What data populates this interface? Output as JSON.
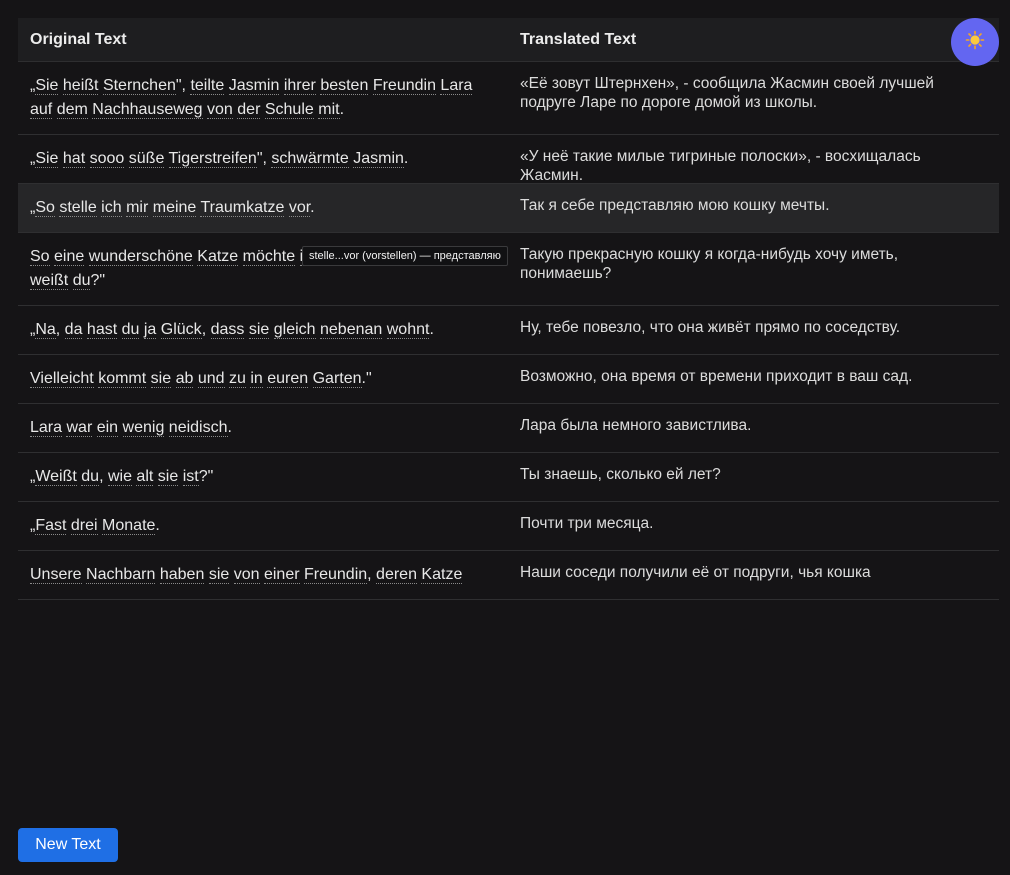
{
  "header": {
    "original_label": "Original Text",
    "translated_label": "Translated Text"
  },
  "theme_toggle": {
    "icon": "sun-icon"
  },
  "rows": [
    {
      "original": [
        {
          "t": "„"
        },
        {
          "w": "Sie"
        },
        {
          "t": " "
        },
        {
          "w": "heißt"
        },
        {
          "t": " "
        },
        {
          "w": "Sternchen"
        },
        {
          "t": "\", "
        },
        {
          "w": "teilte"
        },
        {
          "t": " "
        },
        {
          "w": "Jasmin"
        },
        {
          "t": " "
        },
        {
          "w": "ihrer"
        },
        {
          "t": " "
        },
        {
          "w": "besten"
        },
        {
          "t": " "
        },
        {
          "w": "Freundin"
        },
        {
          "t": " "
        },
        {
          "w": "Lara"
        },
        {
          "t": " "
        },
        {
          "w": "auf"
        },
        {
          "t": " "
        },
        {
          "w": "dem"
        },
        {
          "t": " "
        },
        {
          "w": "Nachhauseweg"
        },
        {
          "t": " "
        },
        {
          "w": "von"
        },
        {
          "t": " "
        },
        {
          "w": "der"
        },
        {
          "t": " "
        },
        {
          "w": "Schule"
        },
        {
          "t": " "
        },
        {
          "w": "mit"
        },
        {
          "t": "."
        }
      ],
      "translated": "«Её зовут Штернхен», - сообщила Жасмин своей лучшей подруге Ларе по дороге домой из школы."
    },
    {
      "original": [
        {
          "t": "„"
        },
        {
          "w": "Sie"
        },
        {
          "t": " "
        },
        {
          "w": "hat"
        },
        {
          "t": " "
        },
        {
          "w": "sooo"
        },
        {
          "t": " "
        },
        {
          "w": "süße"
        },
        {
          "t": " "
        },
        {
          "w": "Tigerstreifen"
        },
        {
          "t": "\", "
        },
        {
          "w": "schwärmte"
        },
        {
          "t": " "
        },
        {
          "w": "Jasmin"
        },
        {
          "t": "."
        }
      ],
      "translated": "«У неё такие милые тигриные полоски», - восхищалась Жасмин."
    },
    {
      "highlighted": true,
      "original": [
        {
          "t": "„"
        },
        {
          "w": "So"
        },
        {
          "t": " "
        },
        {
          "w": "stelle"
        },
        {
          "t": " "
        },
        {
          "w": "ich"
        },
        {
          "t": " "
        },
        {
          "w": "mir"
        },
        {
          "t": " "
        },
        {
          "w": "meine"
        },
        {
          "t": " "
        },
        {
          "w": "Traumkatze"
        },
        {
          "t": " "
        },
        {
          "w": "vor"
        },
        {
          "t": "."
        }
      ],
      "translated": "Так я себе представляю мою кошку мечты."
    },
    {
      "original": [
        {
          "w": "So"
        },
        {
          "t": " "
        },
        {
          "w": "eine"
        },
        {
          "t": " "
        },
        {
          "w": "wunderschöne"
        },
        {
          "t": " "
        },
        {
          "w": "Katze"
        },
        {
          "t": " "
        },
        {
          "w": "möchte"
        },
        {
          "t": " "
        },
        {
          "w": "ich"
        },
        {
          "t": " "
        },
        {
          "w": "irgendwann"
        },
        {
          "t": " "
        },
        {
          "w": "mal"
        },
        {
          "t": " "
        },
        {
          "w": "haben"
        },
        {
          "t": ", "
        },
        {
          "w": "weißt"
        },
        {
          "t": " "
        },
        {
          "w": "du"
        },
        {
          "t": "?\""
        }
      ],
      "translated": "Такую прекрасную кошку я когда-нибудь хочу иметь, понимаешь?"
    },
    {
      "original": [
        {
          "t": "„"
        },
        {
          "w": "Na"
        },
        {
          "t": ", "
        },
        {
          "w": "da"
        },
        {
          "t": " "
        },
        {
          "w": "hast"
        },
        {
          "t": " "
        },
        {
          "w": "du"
        },
        {
          "t": " "
        },
        {
          "w": "ja"
        },
        {
          "t": " "
        },
        {
          "w": "Glück"
        },
        {
          "t": ", "
        },
        {
          "w": "dass"
        },
        {
          "t": " "
        },
        {
          "w": "sie"
        },
        {
          "t": " "
        },
        {
          "w": "gleich"
        },
        {
          "t": " "
        },
        {
          "w": "nebenan"
        },
        {
          "t": " "
        },
        {
          "w": "wohnt"
        },
        {
          "t": "."
        }
      ],
      "translated": "Ну, тебе повезло, что она живёт прямо по соседству."
    },
    {
      "original": [
        {
          "w": "Vielleicht"
        },
        {
          "t": " "
        },
        {
          "w": "kommt"
        },
        {
          "t": " "
        },
        {
          "w": "sie"
        },
        {
          "t": " "
        },
        {
          "w": "ab"
        },
        {
          "t": " "
        },
        {
          "w": "und"
        },
        {
          "t": " "
        },
        {
          "w": "zu"
        },
        {
          "t": " "
        },
        {
          "w": "in"
        },
        {
          "t": " "
        },
        {
          "w": "euren"
        },
        {
          "t": " "
        },
        {
          "w": "Garten"
        },
        {
          "t": ".\""
        }
      ],
      "translated": "Возможно, она время от времени приходит в ваш сад."
    },
    {
      "original": [
        {
          "w": "Lara"
        },
        {
          "t": " "
        },
        {
          "w": "war"
        },
        {
          "t": " "
        },
        {
          "w": "ein"
        },
        {
          "t": " "
        },
        {
          "w": "wenig"
        },
        {
          "t": " "
        },
        {
          "w": "neidisch"
        },
        {
          "t": "."
        }
      ],
      "translated": "Лара была немного завистлива."
    },
    {
      "original": [
        {
          "t": "„"
        },
        {
          "w": "Weißt"
        },
        {
          "t": " "
        },
        {
          "w": "du"
        },
        {
          "t": ", "
        },
        {
          "w": "wie"
        },
        {
          "t": " "
        },
        {
          "w": "alt"
        },
        {
          "t": " "
        },
        {
          "w": "sie"
        },
        {
          "t": " "
        },
        {
          "w": "ist"
        },
        {
          "t": "?\""
        }
      ],
      "translated": "Ты знаешь, сколько ей лет?"
    },
    {
      "original": [
        {
          "t": "„"
        },
        {
          "w": "Fast"
        },
        {
          "t": " "
        },
        {
          "w": "drei"
        },
        {
          "t": " "
        },
        {
          "w": "Monate"
        },
        {
          "t": "."
        }
      ],
      "translated": "Почти три месяца."
    },
    {
      "original": [
        {
          "w": "Unsere"
        },
        {
          "t": " "
        },
        {
          "w": "Nachbarn"
        },
        {
          "t": " "
        },
        {
          "w": "haben"
        },
        {
          "t": " "
        },
        {
          "w": "sie"
        },
        {
          "t": " "
        },
        {
          "w": "von"
        },
        {
          "t": " "
        },
        {
          "w": "einer"
        },
        {
          "t": " "
        },
        {
          "w": "Freundin"
        },
        {
          "t": ", "
        },
        {
          "w": "deren"
        },
        {
          "t": " "
        },
        {
          "w": "Katze"
        }
      ],
      "translated": "Наши соседи получили её от подруги, чья кошка"
    }
  ],
  "tooltip": {
    "text": "stelle...vor (vorstellen) — представляю"
  },
  "actions": {
    "new_text_label": "New Text"
  }
}
